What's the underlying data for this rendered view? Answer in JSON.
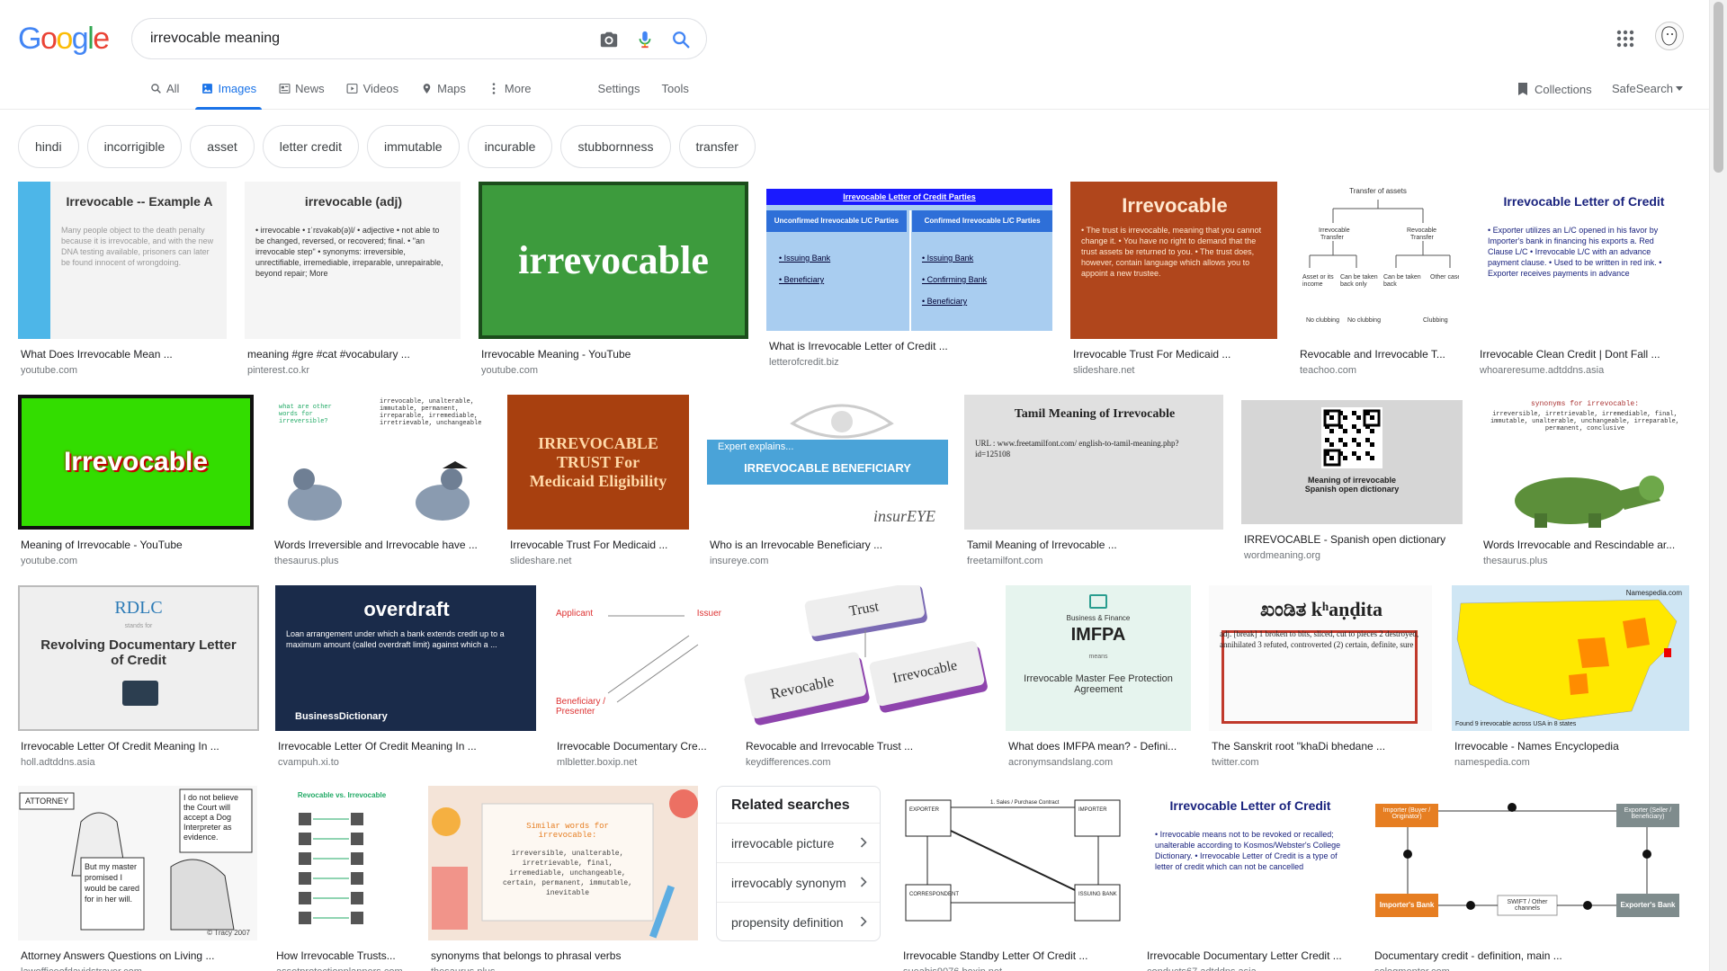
{
  "search": {
    "query": "irrevocable meaning"
  },
  "logo": {
    "text": "Google"
  },
  "tabs": [
    {
      "label": "All",
      "icon": "search-icon"
    },
    {
      "label": "Images",
      "icon": "image-icon"
    },
    {
      "label": "News",
      "icon": "news-icon"
    },
    {
      "label": "Videos",
      "icon": "video-icon"
    },
    {
      "label": "Maps",
      "icon": "map-icon"
    },
    {
      "label": "More",
      "icon": "more-vert-icon"
    }
  ],
  "tools": {
    "settings": "Settings",
    "tools": "Tools",
    "collections": "Collections",
    "safesearch": "SafeSearch"
  },
  "chips": [
    "hindi",
    "incorrigible",
    "asset",
    "letter credit",
    "immutable",
    "incurable",
    "stubbornness",
    "transfer"
  ],
  "results": [
    {
      "caption": "What Does Irrevocable Mean ...",
      "source": "youtube.com",
      "thumb": {
        "type": "text",
        "bg": "#f3f3f3",
        "accent": "#4db6e8",
        "title": "Irrevocable  -- Example A",
        "body": "Many people object to the death penalty because it is irrevocable, and with the new DNA testing available, prisoners can later be found innocent of wrongdoing."
      }
    },
    {
      "caption": "meaning #gre #cat #vocabulary ...",
      "source": "pinterest.co.kr",
      "thumb": {
        "type": "text",
        "bg": "#f5f5f5",
        "title": "irrevocable (adj)",
        "body": "• irrevocable  • ɪˈrɛvəkəb(ə)l/  • adjective  • not able to be changed, reversed, or recovered; final.  • \"an irrevocable step\"  • synonyms: irreversible, unrectifiable, irremediable, irreparable, unrepairable, beyond repair; More"
      }
    },
    {
      "caption": "Irrevocable Meaning - YouTube",
      "source": "youtube.com",
      "thumb": {
        "type": "word",
        "bg": "#3d9b3d",
        "fg": "#ffffff",
        "word": "irrevocable",
        "border": "#1b4d1b"
      }
    },
    {
      "caption": "What is Irrevocable Letter of Credit ...",
      "source": "letterofcredit.biz",
      "thumb": {
        "type": "lc",
        "bg": "#a9cdf0",
        "header": "Irrevocable Letter of Credit Parties",
        "left": "Unconfirmed Irrevocable L/C Parties",
        "right": "Confirmed Irrevocable L/C Parties",
        "litems": [
          "Issuing Bank",
          "Beneficiary"
        ],
        "ritems": [
          "Issuing Bank",
          "Confirming Bank",
          "Beneficiary"
        ]
      }
    },
    {
      "caption": "Irrevocable Trust For Medicaid ...",
      "source": "slideshare.net",
      "thumb": {
        "type": "text",
        "bg": "#b0461c",
        "fg": "#ffe8d0",
        "title": "Irrevocable",
        "body": "• The trust is irrevocable, meaning that you cannot change it. • You have no right to demand that the trust assets be returned to you. • The trust does, however, contain language which allows you to appoint a new trustee."
      }
    },
    {
      "caption": "Revocable and Irrevocable T...",
      "source": "teachoo.com",
      "thumb": {
        "type": "tree",
        "bg": "#ffffff",
        "title": "Transfer of assets"
      }
    },
    {
      "caption": "Irrevocable Clean Credit | Dont Fall ...",
      "source": "whoareresume.adtddns.asia",
      "thumb": {
        "type": "text",
        "bg": "#ffffff",
        "fg": "#1a237e",
        "title": "Irrevocable Letter of Credit",
        "body": "• Exporter utilizes an L/C opened in his favor by Importer's bank in financing his exports  a. Red Clause L/C  • Irrevocable L/C with an advance payment clause. • Used to be written in red ink. • Exporter receives payments in advance"
      }
    },
    {
      "caption": "Meaning of Irrevocable - YouTube",
      "source": "youtube.com",
      "thumb": {
        "type": "word",
        "bg": "#33dd00",
        "fg": "#ffffff",
        "word": "Irrevocable",
        "border": "#111111",
        "label": true
      }
    },
    {
      "caption": "Words Irreversible and Irrevocable have ...",
      "source": "thesaurus.plus",
      "thumb": {
        "type": "birds",
        "bg": "#ffffff",
        "left": "what are other words for irreversible?",
        "right": "irrevocable, unalterable, immutable, permanent, irreparable, irremediable, irretrievable, unchangeable"
      }
    },
    {
      "caption": "Irrevocable Trust For Medicaid ...",
      "source": "slideshare.net",
      "thumb": {
        "type": "word",
        "bg": "#a8400f",
        "fg": "#ffd9a8",
        "word": "IRREVOCABLE TRUST For Medicaid Eligibility",
        "border": "#a8400f",
        "small": true
      }
    },
    {
      "caption": "Who is an Irrevocable Beneficiary ...",
      "source": "insureye.com",
      "thumb": {
        "type": "banner",
        "bg": "#ffffff",
        "band": "#4aa3d8",
        "pre": "Expert explains...",
        "word": "IRREVOCABLE BENEFICIARY",
        "brand": "insurEYE"
      }
    },
    {
      "caption": "Tamil Meaning of Irrevocable ...",
      "source": "freetamilfont.com",
      "thumb": {
        "type": "text",
        "bg": "#e0e0e0",
        "fg": "#222222",
        "title": "Tamil Meaning of Irrevocable",
        "body": "URL : www.freetamilfont.com/ english-to-tamil-meaning.php?id=125108",
        "serif": true
      }
    },
    {
      "caption": "IRREVOCABLE - Spanish open dictionary",
      "source": "wordmeaning.org",
      "thumb": {
        "type": "qr",
        "bg": "#d6d6d6",
        "title": "Meaning of irrevocable Spanish open dictionary"
      }
    },
    {
      "caption": "Words Irrevocable and Rescindable ar...",
      "source": "thesaurus.plus",
      "thumb": {
        "type": "dino",
        "bg": "#ffffff",
        "title": "synonyms for irrevocable:",
        "body": "irreversible, irretrievable, irremediable, final, immutable, unalterable, unchangeable, irreparable, permanent, conclusive"
      }
    },
    {
      "caption": "Irrevocable Letter Of Credit Meaning In ...",
      "source": "holl.adtddns.asia",
      "thumb": {
        "type": "rdlc",
        "bg": "#efefef",
        "top": "RDLC",
        "body": "Revolving Documentary Letter of Credit"
      }
    },
    {
      "caption": "Irrevocable Letter Of Credit Meaning In ...",
      "source": "cvampuh.xi.to",
      "thumb": {
        "type": "text",
        "bg": "#1a2b4a",
        "fg": "#ffffff",
        "title": "overdraft",
        "body": "Loan arrangement under which a bank extends credit up to a maximum amount (called overdraft limit) against which a ...",
        "brand": "BusinessDictionary"
      }
    },
    {
      "caption": "Irrevocable Documentary Cre...",
      "source": "mlbletter.boxip.net",
      "thumb": {
        "type": "flow",
        "bg": "#ffffff",
        "a": "Applicant",
        "b": "Issuer",
        "c": "Beneficiary / Presenter"
      }
    },
    {
      "caption": "Revocable and Irrevocable Trust ...",
      "source": "keydifferences.com",
      "thumb": {
        "type": "trust",
        "bg": "#ffffff",
        "a": "Trust",
        "b": "Revocable",
        "c": "Irrevocable"
      }
    },
    {
      "caption": "What does IMFPA mean? - Defini...",
      "source": "acronymsandslang.com",
      "thumb": {
        "type": "acr",
        "bg": "#e6f4ee",
        "pre": "Business & Finance",
        "word": "IMFPA",
        "mid": "means",
        "body": "Irrevocable Master Fee Protection Agreement"
      }
    },
    {
      "caption": "The Sanskrit root \"khaDi bhedane ...",
      "source": "twitter.com",
      "thumb": {
        "type": "text",
        "bg": "#fafafa",
        "fg": "#222222",
        "title": "ಖಂಡಿತ kʰaṇḍita",
        "body": "adj. [break] 1 broken to bits, sliced, cut to pieces 2 destroyed, annihilated 3 refuted, controverted (2) certain, definite, sure",
        "serif": true,
        "boxed": true
      }
    },
    {
      "caption": "Irrevocable - Names Encyclopedia",
      "source": "namespedia.com",
      "thumb": {
        "type": "map",
        "bg": "#cfe6f4"
      }
    },
    {
      "caption": "Attorney Answers Questions on Living ...",
      "source": "lawofficeofdavidstrayer.com",
      "thumb": {
        "type": "cartoon",
        "bg": "#f7f7f7",
        "a": "ATTORNEY",
        "b": "I do not believe the Court will accept a Dog Interpreter as evidence.",
        "c": "But my master promised I would be cared for in her will."
      }
    },
    {
      "caption": "How Irrevocable Trusts...",
      "source": "assetprotectionplanners.com",
      "thumb": {
        "type": "chart2",
        "bg": "#ffffff",
        "title": "Revocable vs. Irrevocable"
      }
    },
    {
      "caption": "synonyms that belongs to phrasal verbs",
      "source": "thesaurus.plus",
      "thumb": {
        "type": "desk",
        "bg": "#f4e4d8",
        "title": "Similar words for irrevocable:",
        "body": "irreversible, unalterable, irretrievable, final, irremediable, unchangeable, certain, permanent, immutable, inevitable"
      }
    },
    {
      "caption": "Irrevocable Standby Letter Of Credit ...",
      "source": "sueabis9076.boxip.net",
      "thumb": {
        "type": "diagram",
        "bg": "#ffffff"
      }
    },
    {
      "caption": "Irrevocable Documentary Letter Credit ...",
      "source": "conducts67.adtddns.asia",
      "thumb": {
        "type": "text",
        "bg": "#ffffff",
        "fg": "#1a237e",
        "title": "Irrevocable Letter of Credit",
        "body": "• Irrevocable means not to be revoked or recalled; unalterable according to Kosmos/Webster's College Dictionary. • Irrevocable Letter of Credit is a type of letter of credit which can not be cancelled"
      }
    },
    {
      "caption": "Documentary credit - definition, main ...",
      "source": "sologmentor.com",
      "thumb": {
        "type": "orange",
        "bg": "#ffffff",
        "a": "Importer (Buyer / Originator)",
        "b": "Exporter (Seller / Beneficiary)",
        "c": "Importer's Bank",
        "d": "Exporter's Bank",
        "e": "SWIFT / Other channels"
      }
    }
  ],
  "related": {
    "title": "Related searches",
    "items": [
      "irrevocable picture",
      "irrevocably synonym",
      "propensity definition"
    ]
  }
}
